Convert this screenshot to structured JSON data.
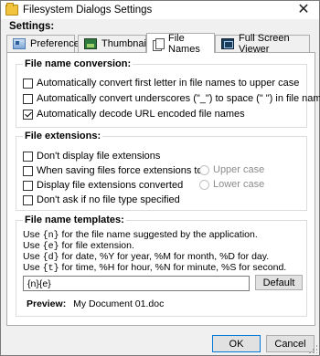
{
  "window": {
    "title": "Filesystem Dialogs Settings",
    "close_symbol": "✕"
  },
  "settings_label": "Settings:",
  "tabs": [
    {
      "label": "Preferences",
      "icon": "preferences-icon"
    },
    {
      "label": "Thumbnails",
      "icon": "thumbnails-icon"
    },
    {
      "label": "File Names",
      "icon": "file-names-icon",
      "active": true
    },
    {
      "label": "Full Screen Viewer",
      "icon": "full-screen-viewer-icon"
    }
  ],
  "conversion": {
    "title": "File name conversion:",
    "options": [
      {
        "label": "Automatically convert first letter in file names to upper case",
        "checked": false
      },
      {
        "label": "Automatically convert underscores (\"_\") to space (\" \") in file names",
        "checked": false
      },
      {
        "label": "Automatically decode URL encoded file names",
        "checked": true
      }
    ]
  },
  "extensions": {
    "title": "File extensions:",
    "options": [
      {
        "label": "Don't display file extensions",
        "checked": false
      },
      {
        "label": "When saving files force extensions to:",
        "checked": false
      },
      {
        "label": "Display file extensions converted",
        "checked": false
      },
      {
        "label": "Don't ask if no file type specified",
        "checked": false
      }
    ],
    "radios": [
      {
        "label": "Upper case",
        "selected": false,
        "enabled": false
      },
      {
        "label": "Lower case",
        "selected": false,
        "enabled": false
      }
    ]
  },
  "templates": {
    "title": "File name templates:",
    "help": [
      {
        "pre": "Use ",
        "code": "{n}",
        "post": " for the file name suggested by the application."
      },
      {
        "pre": "Use ",
        "code": "{e}",
        "post": " for file extension."
      },
      {
        "pre": "Use ",
        "code": "{d}",
        "post": " for date, %Y for year, %M for month, %D for day."
      },
      {
        "pre": "Use ",
        "code": "{t}",
        "post": " for time, %H for hour, %N for minute, %S for second."
      }
    ],
    "input_value": "{n}{e}",
    "default_button": "Default",
    "preview_label": "Preview:",
    "preview_value": "My Document 01.doc"
  },
  "buttons": {
    "ok": "OK",
    "cancel": "Cancel"
  },
  "colors": {
    "window_bg": "#f0f0f0",
    "panel_bg": "#ffffff",
    "ok_border": "#0078d7"
  }
}
